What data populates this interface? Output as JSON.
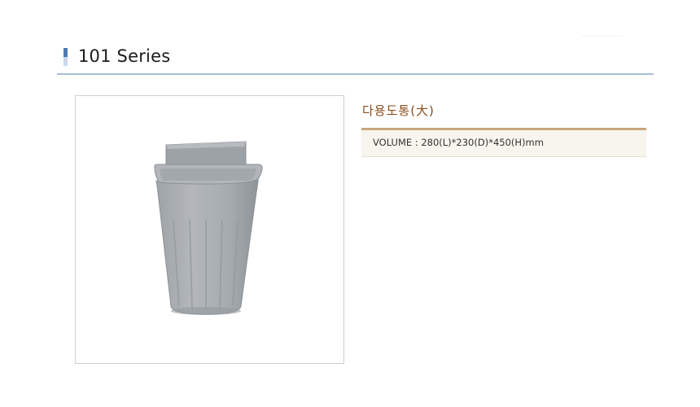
{
  "page": {
    "title": "101 Series"
  },
  "product": {
    "name": "다용도통(大)",
    "spec": "VOLUME : 280(L)*230(D)*450(H)mm",
    "image_icon": "wastebasket-product-photo",
    "colors": {
      "accent": "#4d79b3",
      "header_line": "#a7bdd6",
      "name": "#8a4b19",
      "spec_border": "#c8a57f",
      "bin": "#a6abb0"
    }
  }
}
